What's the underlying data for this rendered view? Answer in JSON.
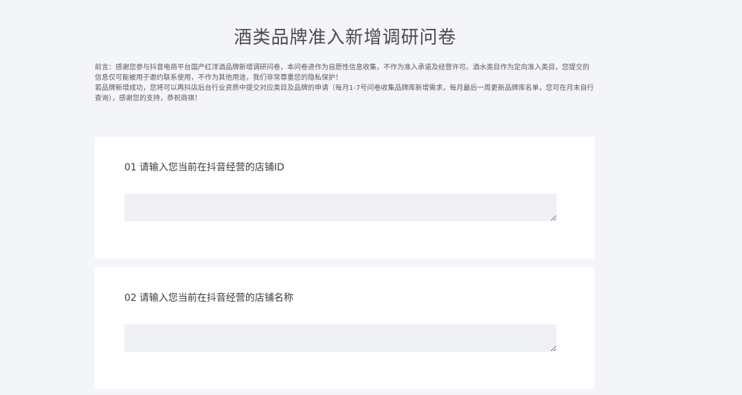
{
  "survey": {
    "title": "酒类品牌准入新增调研问卷",
    "intro": {
      "paragraph1": "前言：感谢您参与抖音电商平台国产红洋酒品牌新增调研问卷，本问卷进作为自愿性信息收集，不作为准入承诺及经营许可。酒水类目作为定向准入类目，您提交的信息仅可能被用于邀约联系使用，不作为其他用途，我们非常尊重您的隐私保护！",
      "paragraph2": "若品牌新增成功，您将可以再抖店后台行业资质中提交对应类目及品牌的申请（每月1-7号问卷收集品牌库新增需求，每月最后一周更新品牌库名单，您可在月末自行查询），感谢您的支持，恭祝商祺！"
    },
    "questions": [
      {
        "number": "01",
        "label": "请输入您当前在抖音经营的店铺ID",
        "value": "",
        "placeholder": ""
      },
      {
        "number": "02",
        "label": "请输入您当前在抖音经营的店铺名称",
        "value": "",
        "placeholder": ""
      }
    ]
  }
}
